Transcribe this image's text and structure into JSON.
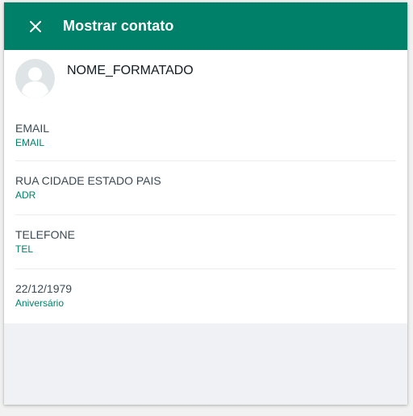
{
  "header": {
    "title": "Mostrar contato"
  },
  "contact": {
    "name": "NOME_FORMATADO"
  },
  "fields": [
    {
      "value": "EMAIL",
      "label": "EMAIL"
    },
    {
      "value": "RUA CIDADE ESTADO PAIS",
      "label": "ADR"
    },
    {
      "value": "TELEFONE",
      "label": "TEL"
    },
    {
      "value": "22/12/1979",
      "label": "Aniversário"
    }
  ],
  "colors": {
    "header": "#008069",
    "accent": "#008069",
    "panel_bg": "#eff1f4"
  },
  "icons": {
    "close": "close-icon",
    "avatar": "default-avatar-icon"
  }
}
